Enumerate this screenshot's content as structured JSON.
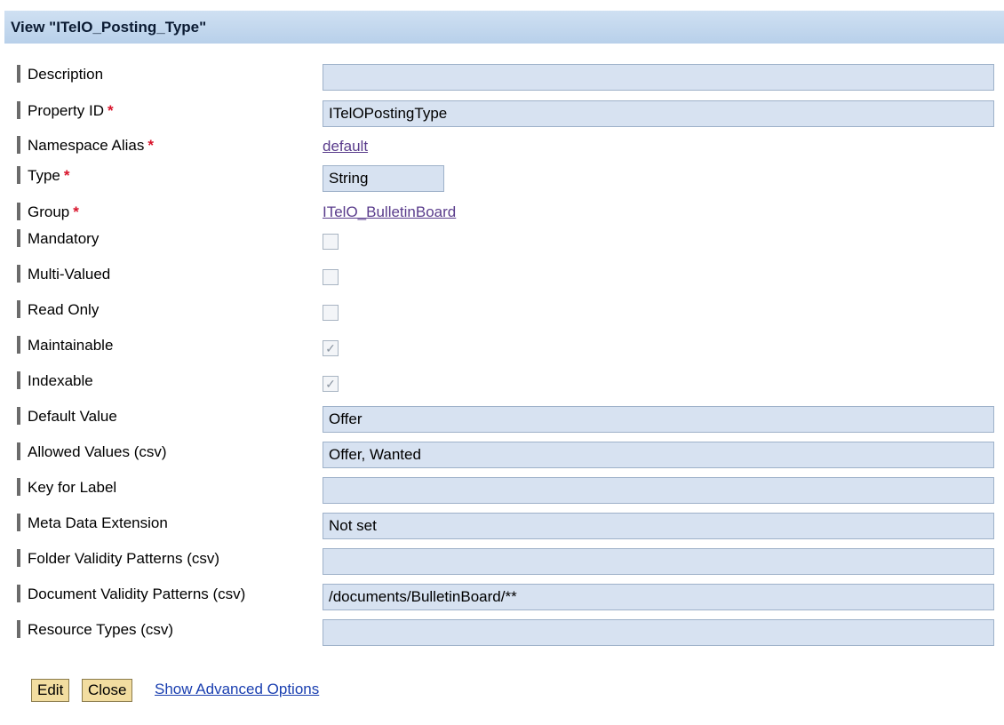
{
  "header": {
    "title": "View \"ITelO_Posting_Type\""
  },
  "fields": {
    "description": {
      "label": "Description",
      "value": ""
    },
    "property_id": {
      "label": "Property ID",
      "required": "*",
      "value": "ITelOPostingType"
    },
    "namespace_alias": {
      "label": "Namespace Alias",
      "required": "*",
      "value": "default"
    },
    "type": {
      "label": "Type",
      "required": "*",
      "value": "String"
    },
    "group": {
      "label": "Group",
      "required": "*",
      "value": "ITelO_BulletinBoard"
    },
    "mandatory": {
      "label": "Mandatory",
      "checked": false
    },
    "multi_valued": {
      "label": "Multi-Valued",
      "checked": false
    },
    "read_only": {
      "label": "Read Only",
      "checked": false
    },
    "maintainable": {
      "label": "Maintainable",
      "checked": true,
      "mark": "✓"
    },
    "indexable": {
      "label": "Indexable",
      "checked": true,
      "mark": "✓"
    },
    "default_value": {
      "label": "Default Value",
      "value": "Offer"
    },
    "allowed_values": {
      "label": "Allowed Values (csv)",
      "value": "Offer, Wanted"
    },
    "key_for_label": {
      "label": "Key for Label",
      "value": ""
    },
    "meta_data_extension": {
      "label": "Meta Data Extension",
      "value": "Not set"
    },
    "folder_validity": {
      "label": "Folder Validity Patterns (csv)",
      "value": ""
    },
    "document_validity": {
      "label": "Document Validity Patterns (csv)",
      "value": "/documents/BulletinBoard/**"
    },
    "resource_types": {
      "label": "Resource Types (csv)",
      "value": ""
    }
  },
  "actions": {
    "edit_label": "Edit",
    "close_label": "Close",
    "advanced_label": "Show Advanced Options"
  },
  "colors": {
    "header_bg": "#c4d8ee",
    "field_bg": "#d7e2f1",
    "button_bg": "#f2dda0",
    "required": "#d8132a",
    "link": "#1a3fb0"
  }
}
